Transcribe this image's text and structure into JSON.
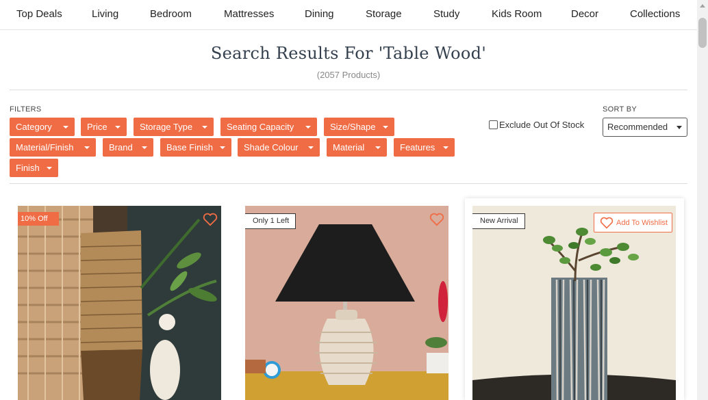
{
  "nav": {
    "items": [
      "Top Deals",
      "Living",
      "Bedroom",
      "Mattresses",
      "Dining",
      "Storage",
      "Study",
      "Kids Room",
      "Decor",
      "Collections"
    ]
  },
  "search": {
    "title": "Search Results For 'Table Wood'",
    "count": "(2057 Products)"
  },
  "filters": {
    "label": "FILTERS",
    "chips": [
      "Category",
      "Price",
      "Storage Type",
      "Seating Capacity",
      "Size/Shape",
      "Material/Finish",
      "Brand",
      "Base Finish",
      "Shade Colour",
      "Material",
      "Features",
      "Finish"
    ],
    "exclude_label": "Exclude Out Of Stock",
    "exclude_checked": false
  },
  "sort": {
    "label": "SORT BY",
    "selected": "Recommended"
  },
  "products": [
    {
      "badge": "10% Off",
      "image": "woven-vase-lamp-photo",
      "wishlisted": false
    },
    {
      "badge": "Only 1 Left",
      "image": "black-shade-table-lamp-photo",
      "wishlisted": false
    },
    {
      "badge": "New Arrival",
      "image": "wooden-vase-plant-photo",
      "wishlist_label": "Add To Wishlist",
      "wishlisted": false
    }
  ],
  "colors": {
    "accent": "#ef6c45",
    "title": "#34404d"
  },
  "icons": {
    "wishlist": "heart-icon",
    "dropdown": "chevron-down-icon"
  }
}
